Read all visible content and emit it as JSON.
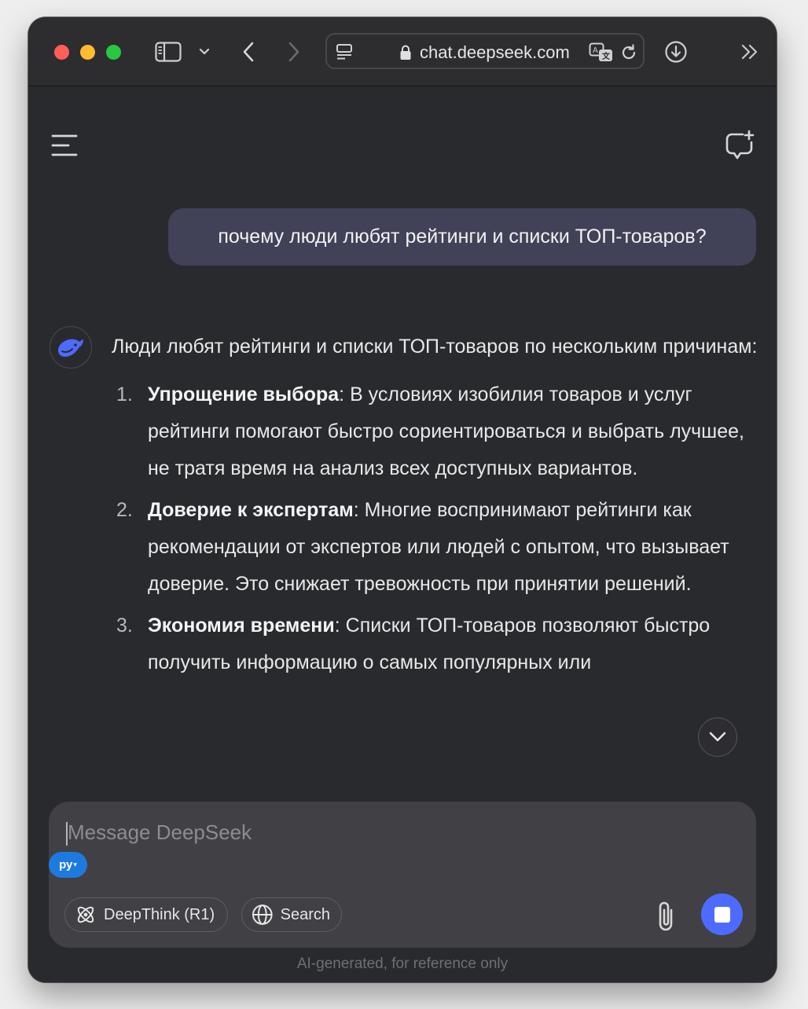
{
  "browser": {
    "url": "chat.deepseek.com"
  },
  "chat": {
    "user_message": "почему люди любят рейтинги и списки ТОП-товаров?",
    "assistant_intro": "Люди любят рейтинги и списки ТОП-товаров по нескольким причинам:",
    "points": [
      {
        "num": "1.",
        "title": "Упрощение выбора",
        "text": ": В условиях изобилия товаров и услуг рейтинги помогают быстро сориентироваться и выбрать лучшее, не тратя время на анализ всех доступных вариантов."
      },
      {
        "num": "2.",
        "title": "Доверие к экспертам",
        "text": ": Многие воспринимают рейтинги как рекомендации от экспертов или людей с опытом, что вызывает доверие. Это снижает тревожность при принятии решений."
      },
      {
        "num": "3.",
        "title": "Экономия времени",
        "text": ": Списки ТОП-товаров позволяют быстро получить информацию о самых популярных или"
      }
    ]
  },
  "composer": {
    "placeholder": "Message DeepSeek",
    "language_badge": "ру",
    "deepthink_label": "DeepThink (R1)",
    "search_label": "Search"
  },
  "footer": {
    "disclaimer": "AI-generated, for reference only"
  },
  "colors": {
    "accent": "#4d6bfe",
    "user_bubble": "#414158",
    "background": "#292a2d"
  },
  "icons": [
    "sidebar-icon",
    "chevron-down-icon",
    "back-icon",
    "forward-icon",
    "page-menu-icon",
    "lock-icon",
    "translate-icon",
    "reload-icon",
    "download-icon",
    "overflow-icon",
    "menu-icon",
    "new-chat-icon",
    "deepseek-logo-icon",
    "atom-icon",
    "globe-icon",
    "paperclip-icon",
    "stop-icon"
  ]
}
